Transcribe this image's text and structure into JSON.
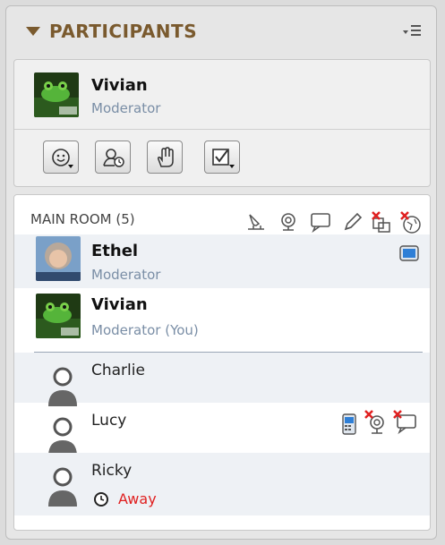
{
  "panel": {
    "title": "PARTICIPANTS",
    "collapse_icon": "triangle-down-icon",
    "menu_icon": "panel-menu-icon"
  },
  "self": {
    "name": "Vivian",
    "role": "Moderator",
    "toolbar": [
      {
        "id": "emoticon",
        "icon": "emoticon-icon"
      },
      {
        "id": "status",
        "icon": "user-clock-icon"
      },
      {
        "id": "raise-hand",
        "icon": "hand-icon"
      },
      {
        "id": "poll",
        "icon": "checkbox-icon"
      }
    ]
  },
  "room": {
    "label": "MAIN ROOM (5)",
    "column_icons": [
      "presenter-icon",
      "webcam-icon",
      "chat-icon",
      "pencil-icon",
      "app-share-disabled-icon",
      "web-tour-disabled-icon"
    ],
    "participants": [
      {
        "name": "Ethel",
        "role": "Moderator",
        "badge_icon": "monitor-icon"
      },
      {
        "name": "Vivian",
        "role": "Moderator (You)"
      },
      {
        "name": "Charlie"
      },
      {
        "name": "Lucy",
        "badge_icons": [
          "phone-icon",
          "webcam-disabled-icon",
          "chat-disabled-icon"
        ]
      },
      {
        "name": "Ricky",
        "status": "Away",
        "status_icon": "clock-icon"
      }
    ]
  },
  "colors": {
    "header_text": "#7a5a2e",
    "role_text": "#7a8ea6",
    "away": "#e02020",
    "disabled_x": "#e02020"
  }
}
